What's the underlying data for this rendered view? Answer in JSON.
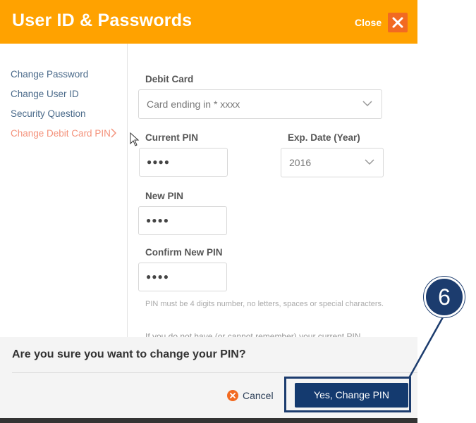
{
  "header": {
    "title": "User ID & Passwords",
    "close_label": "Close"
  },
  "sidebar": {
    "items": [
      {
        "label": "Change Password",
        "active": false
      },
      {
        "label": "Change User ID",
        "active": false
      },
      {
        "label": "Security Question",
        "active": false
      },
      {
        "label": "Change Debit Card PIN",
        "active": true
      }
    ]
  },
  "form": {
    "debit_card": {
      "label": "Debit Card",
      "value": "Card ending in * xxxx"
    },
    "current_pin": {
      "label": "Current PIN",
      "value": "●●●●"
    },
    "exp_date": {
      "label": "Exp. Date (Year)",
      "value": "2016"
    },
    "new_pin": {
      "label": "New PIN",
      "value": "●●●●"
    },
    "confirm_pin": {
      "label": "Confirm New PIN",
      "value": "●●●●"
    },
    "helper_text": "PIN must be 4 digits number, no letters, spaces or special characters.",
    "partial_text": "If you do not have (or cannot remember) your current PIN"
  },
  "confirm_dialog": {
    "question": "Are you sure you want to change your PIN?",
    "cancel_label": "Cancel",
    "confirm_label": "Yes, Change PIN"
  },
  "annotation": {
    "step_number": "6"
  },
  "colors": {
    "header_bg": "#ffa200",
    "close_box": "#f26a21",
    "active_nav": "#f4927b",
    "nav_link": "#4a6a8a",
    "primary_button": "#143a6f",
    "annotation": "#1c3c6e"
  }
}
